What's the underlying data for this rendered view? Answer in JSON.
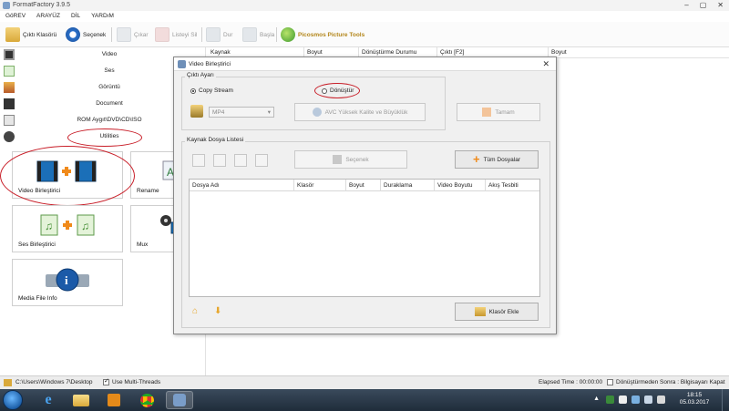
{
  "window": {
    "title": "FormatFactory 3.9.5",
    "controls": [
      "–",
      "▢",
      "✕"
    ]
  },
  "menu": [
    "GöREV",
    "ARAYÜZ",
    "DİL",
    "YARDıM"
  ],
  "toolbar": {
    "output_folder": "Çıktı Klasörü",
    "options": "Seçenek",
    "remove": "Çıkar",
    "clear_list": "Listeyi Sil",
    "stop": "Dur",
    "start": "Başla",
    "picosmos": "Picosmos Picture Tools"
  },
  "categories": [
    "Video",
    "Ses",
    "Görüntü",
    "Document",
    "ROM Aygıt\\DVD\\CD\\ISO",
    "Utilities"
  ],
  "tiles": {
    "video_joiner": "Video Birleştirici",
    "rename": "Rename",
    "audio_joiner": "Ses Birleştirici",
    "mux": "Mux",
    "media_info": "Media File Info"
  },
  "list_columns": [
    "Kaynak",
    "Boyut",
    "Dönüştürme Durumu",
    "Çıktı [F2]",
    "Boyut"
  ],
  "dialog": {
    "title": "Video Birleştirici",
    "close": "✕",
    "output_group": "Çıktı Ayarı",
    "copy_stream": "Copy Stream",
    "convert": "Dönüştür",
    "format_value": "MP4",
    "quality_button": "AVC Yüksek Kalite ve Büyüklük",
    "ok_button": "Tamam",
    "source_group": "Kaynak Dosya Listesi",
    "options_button": "Seçenek",
    "all_files_button": "Tüm Dosyalar",
    "columns": [
      "Dosya Adı",
      "Klasör",
      "Boyut",
      "Duraklama",
      "Video Boyutu",
      "Akış Tesbiti"
    ],
    "add_folder_button": "Klasör Ekle"
  },
  "statusbar": {
    "path": "C:\\Users\\Windows 7\\Desktop",
    "multithread": "Use Multi-Threads",
    "elapsed": "Elapsed Time : 00:00:00",
    "after_convert": "Dönüştürmeden Sonra : Bilgisayarı Kapat"
  },
  "taskbar": {
    "time": "18:15",
    "date": "05.03.2017"
  },
  "colors": {
    "accent_red": "#c81e28",
    "taskbar": "#1f2c3a",
    "picosmos": "#b3861a"
  }
}
